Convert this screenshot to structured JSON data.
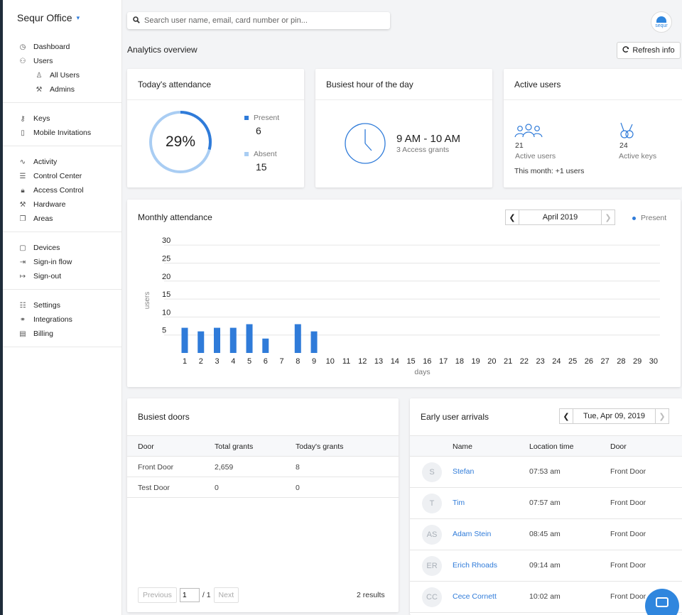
{
  "brand": {
    "name": "Sequr Office",
    "caret": "▾"
  },
  "search": {
    "placeholder": "Search user name, email, card number or pin..."
  },
  "logo": {
    "text": "sequr"
  },
  "sidebar": {
    "groups": [
      [
        {
          "icon": "dashboard-icon",
          "label": "Dashboard"
        },
        {
          "icon": "users-icon",
          "label": "Users"
        },
        {
          "icon": "user-icon",
          "label": "All Users",
          "sub": true
        },
        {
          "icon": "admin-icon",
          "label": "Admins",
          "sub": true
        }
      ],
      [
        {
          "icon": "key-icon",
          "label": "Keys"
        },
        {
          "icon": "phone-icon",
          "label": "Mobile Invitations"
        }
      ],
      [
        {
          "icon": "activity-icon",
          "label": "Activity"
        },
        {
          "icon": "server-icon",
          "label": "Control Center"
        },
        {
          "icon": "lock-icon",
          "label": "Access Control"
        },
        {
          "icon": "wrench-icon",
          "label": "Hardware"
        },
        {
          "icon": "areas-icon",
          "label": "Areas"
        }
      ],
      [
        {
          "icon": "device-icon",
          "label": "Devices"
        },
        {
          "icon": "sign-in-icon",
          "label": "Sign-in flow"
        },
        {
          "icon": "sign-out-icon",
          "label": "Sign-out"
        }
      ],
      [
        {
          "icon": "sliders-icon",
          "label": "Settings"
        },
        {
          "icon": "link-icon",
          "label": "Integrations"
        },
        {
          "icon": "billing-icon",
          "label": "Billing"
        }
      ]
    ]
  },
  "header": {
    "title": "Analytics overview",
    "refresh_label": "Refresh info"
  },
  "attendance": {
    "title": "Today's attendance",
    "percent": "29%",
    "percent_value": 29,
    "present_label": "Present",
    "present": "6",
    "absent_label": "Absent",
    "absent": "15"
  },
  "busiest_hour": {
    "title": "Busiest hour of the day",
    "hour": "9 AM - 10 AM",
    "grants": "3 Access grants"
  },
  "active_users": {
    "title": "Active users",
    "users_count": "21",
    "users_label": "Active users",
    "keys_count": "24",
    "keys_label": "Active keys",
    "month": "This month: +1 users"
  },
  "monthly": {
    "title": "Monthly attendance",
    "month": "April 2019",
    "legend": "Present"
  },
  "chart_data": {
    "type": "bar",
    "title": "Monthly attendance",
    "xlabel": "days",
    "ylabel": "users",
    "categories": [
      "1",
      "2",
      "3",
      "4",
      "5",
      "6",
      "7",
      "8",
      "9",
      "10",
      "11",
      "12",
      "13",
      "14",
      "15",
      "16",
      "17",
      "18",
      "19",
      "20",
      "21",
      "22",
      "23",
      "24",
      "25",
      "26",
      "27",
      "28",
      "29",
      "30"
    ],
    "series": [
      {
        "name": "Present",
        "values": [
          7,
          6,
          7,
          7,
          8,
          4,
          0,
          8,
          6,
          0,
          0,
          0,
          0,
          0,
          0,
          0,
          0,
          0,
          0,
          0,
          0,
          0,
          0,
          0,
          0,
          0,
          0,
          0,
          0,
          0
        ]
      }
    ],
    "yticks": [
      5,
      10,
      15,
      20,
      25,
      30
    ],
    "ylim": [
      0,
      32
    ],
    "grid": true,
    "legend": "top-right",
    "color": "#2f7bd9"
  },
  "doors": {
    "title": "Busiest doors",
    "headers": [
      "Door",
      "Total grants",
      "Today's grants"
    ],
    "rows": [
      [
        "Front Door",
        "2,659",
        "8"
      ],
      [
        "Test Door",
        "0",
        "0"
      ]
    ],
    "prev": "Previous",
    "page": "1",
    "total": "/ 1",
    "next": "Next",
    "results": "2 results"
  },
  "early": {
    "title": "Early user arrivals",
    "date": "Tue, Apr 09, 2019",
    "headers": [
      "Name",
      "Location time",
      "Door"
    ],
    "rows": [
      {
        "initials": "S",
        "name": "Stefan",
        "time": "07:53 am",
        "door": "Front Door"
      },
      {
        "initials": "T",
        "name": "Tim",
        "time": "07:57 am",
        "door": "Front Door"
      },
      {
        "initials": "AS",
        "name": "Adam Stein",
        "time": "08:45 am",
        "door": "Front Door"
      },
      {
        "initials": "ER",
        "name": "Erich Rhoads",
        "time": "09:14 am",
        "door": "Front Door"
      },
      {
        "initials": "CC",
        "name": "Cece Cornett",
        "time": "10:02 am",
        "door": "Front Door"
      }
    ]
  },
  "colors": {
    "accent": "#2f7bd9",
    "ring_track": "#a9cdf3"
  }
}
